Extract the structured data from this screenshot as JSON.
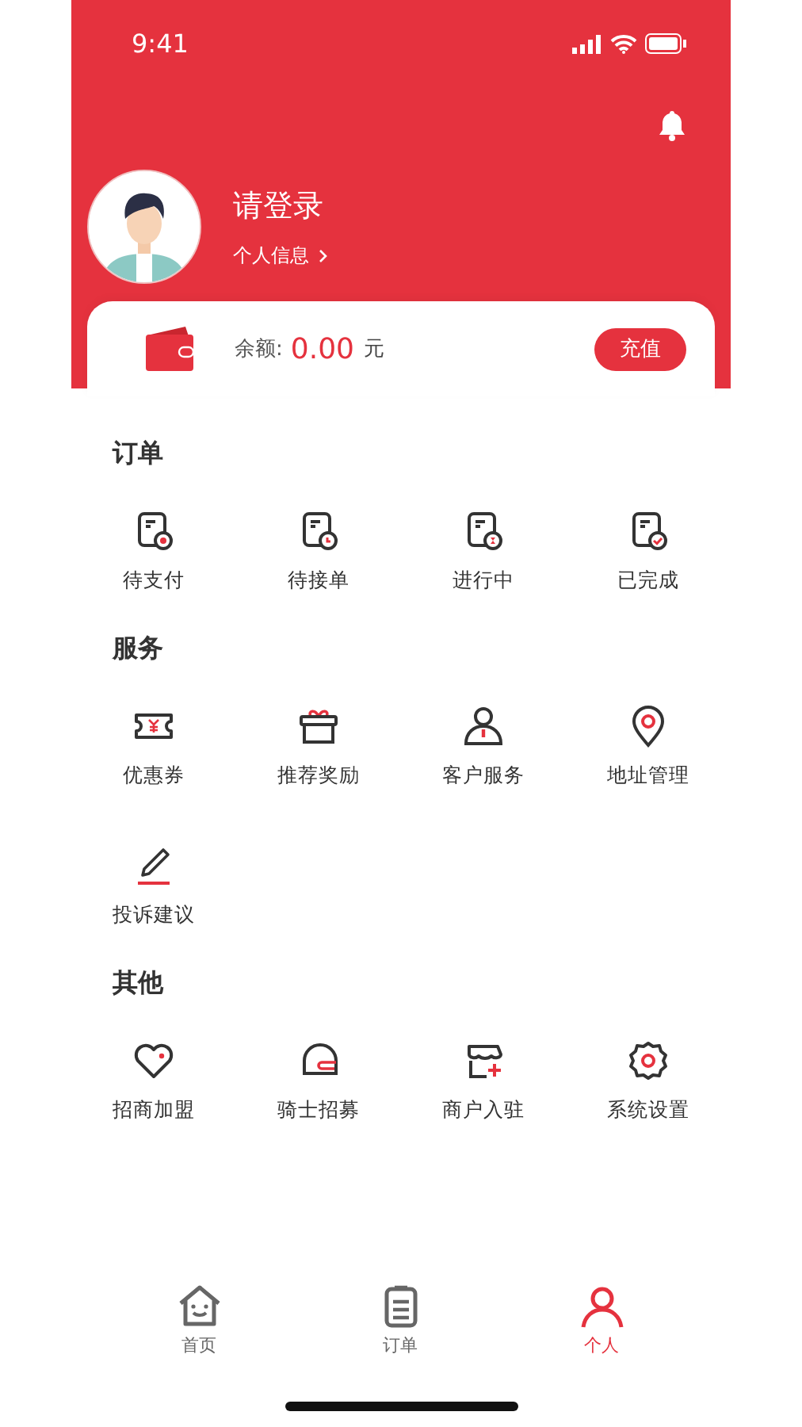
{
  "status_bar": {
    "time": "9:41"
  },
  "profile": {
    "title": "请登录",
    "link": "个人信息"
  },
  "balance": {
    "label": "余额:",
    "amount": "0.00",
    "unit": "元",
    "button": "充值"
  },
  "sections": [
    {
      "title": "订单",
      "items": [
        {
          "label": "待支付",
          "kind": "pay"
        },
        {
          "label": "待接单",
          "kind": "clock"
        },
        {
          "label": "进行中",
          "kind": "hourglass"
        },
        {
          "label": "已完成",
          "kind": "done"
        }
      ]
    },
    {
      "title": "服务",
      "items": [
        {
          "label": "优惠券",
          "kind": "coupon"
        },
        {
          "label": "推荐奖励",
          "kind": "gift"
        },
        {
          "label": "客户服务",
          "kind": "person"
        },
        {
          "label": "地址管理",
          "kind": "pin"
        },
        {
          "label": "投诉建议",
          "kind": "pencil"
        }
      ]
    },
    {
      "title": "其他",
      "items": [
        {
          "label": "招商加盟",
          "kind": "heart"
        },
        {
          "label": "骑士招募",
          "kind": "helmet"
        },
        {
          "label": "商户入驻",
          "kind": "shop"
        },
        {
          "label": "系统设置",
          "kind": "gear"
        }
      ]
    }
  ],
  "tabs": [
    {
      "label": "首页",
      "kind": "home",
      "selected": false
    },
    {
      "label": "订单",
      "kind": "list",
      "selected": false
    },
    {
      "label": "个人",
      "kind": "user",
      "selected": true
    }
  ]
}
